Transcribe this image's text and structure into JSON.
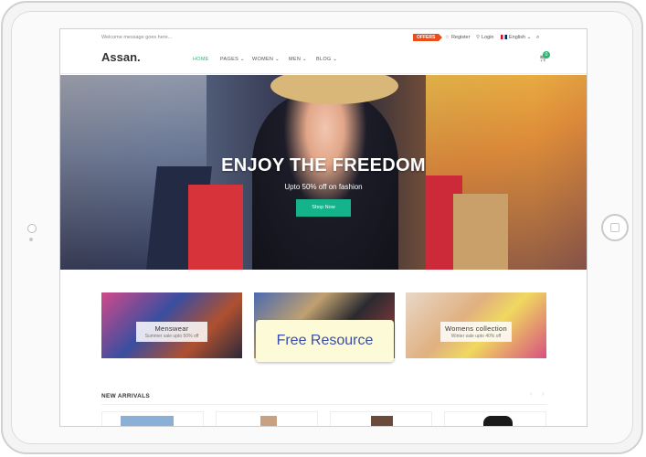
{
  "topbar": {
    "welcome": "Welcome message goes here...",
    "offers": "OFFERS",
    "register": "Register",
    "login": "Login",
    "language": "English"
  },
  "nav": {
    "logo": "Assan.",
    "items": [
      {
        "label": "HOME"
      },
      {
        "label": "PAGES"
      },
      {
        "label": "WOMEN"
      },
      {
        "label": "MEN"
      },
      {
        "label": "BLOG"
      }
    ],
    "cart_count": "0"
  },
  "hero": {
    "title": "ENJOY THE FREEDOM",
    "subtitle": "Upto 50% off on fashion",
    "button": "Shop Now"
  },
  "promos": [
    {
      "title": "Menswear",
      "subtitle": "Summer sale upto 50% off"
    },
    {
      "title": "Womens collection",
      "subtitle": "Winter sale upto 40% off"
    }
  ],
  "overlay": {
    "text": "Free Resource"
  },
  "arrivals": {
    "title": "NEW ARRIVALS"
  },
  "colors": {
    "accent": "#2bb673",
    "offers": "#e94e1b",
    "button": "#14b38b"
  }
}
